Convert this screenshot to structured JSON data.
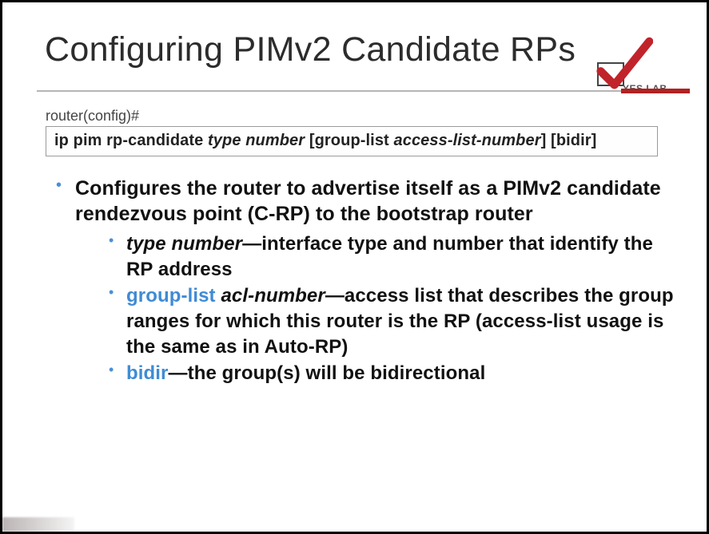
{
  "title": "Configuring PIMv2 Candidate RPs",
  "logo": {
    "text": "YES LAB"
  },
  "prompt": "router(config)#",
  "cmd": {
    "base": "ip pim rp-candidate",
    "arg1": "type number",
    "open1": "[",
    "kw1": "group-list",
    "arg2": "access-list-number",
    "close1": "]",
    "open2": "[",
    "kw2": "bidir",
    "close2": "]"
  },
  "bullets": {
    "main": "Configures the router to advertise itself as a PIMv2 candidate rendezvous point (C-RP) to the bootstrap router",
    "s1_arg": "type number",
    "s1_rest": "—interface type and number that identify the RP address",
    "s2_kw": "group-list",
    "s2_arg": "acl-number",
    "s2_rest": "—access list that describes the group ranges for which this router is the RP (access-list usage is the same as in Auto-RP)",
    "s3_kw": "bidir",
    "s3_rest": "—the group(s) will be bidirectional"
  }
}
